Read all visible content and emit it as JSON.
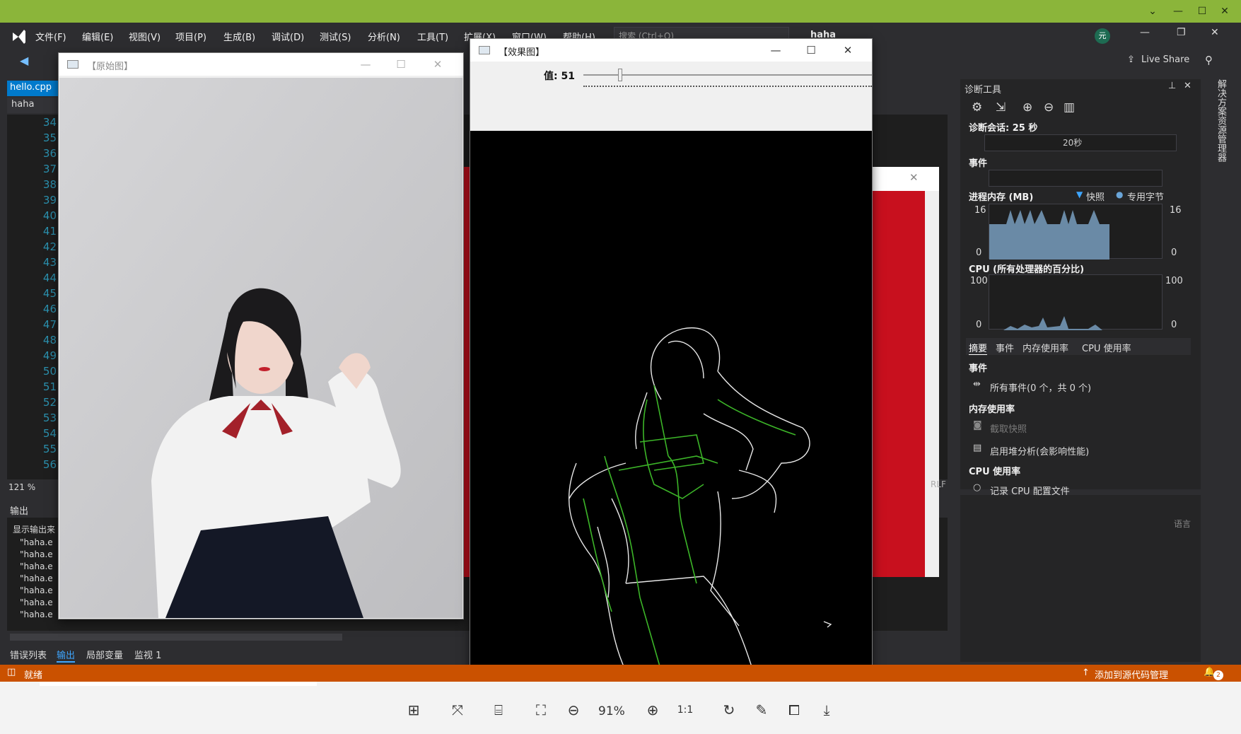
{
  "vs": {
    "menu": [
      "文件(F)",
      "编辑(E)",
      "视图(V)",
      "项目(P)",
      "生成(B)",
      "调试(D)",
      "测试(S)",
      "分析(N)",
      "工具(T)",
      "扩展(X)",
      "窗口(W)",
      "帮助(H)"
    ],
    "search_placeholder": "搜索 (Ctrl+Q)",
    "solution_name": "haha",
    "avatar": "元",
    "live_share": "Live Share",
    "editor_tab": "hello.cpp",
    "project_dropdown": "haha",
    "line_numbers": [
      "34",
      "35",
      "36",
      "37",
      "38",
      "39",
      "40",
      "41",
      "42",
      "43",
      "44",
      "45",
      "46",
      "47",
      "48",
      "49",
      "50",
      "51",
      "52",
      "53",
      "54",
      "55",
      "56"
    ],
    "zoom": "121 %",
    "output_title": "输出",
    "output_source_label": "显示输出来",
    "output_lines": [
      "\"haha.e",
      "\"haha.e",
      "\"haha.e",
      "\"haha.e",
      "\"haha.e",
      "\"haha.e",
      "\"haha.e"
    ],
    "bottom_tabs": [
      "错误列表",
      "输出",
      "局部变量",
      "监视 1"
    ],
    "status_text": "就绪",
    "source_control": "添加到源代码管理",
    "notification_count": "2",
    "side_tab": "解决方案资源管理器",
    "rlf": "RLF",
    "lang_label": "语言"
  },
  "diagnostics": {
    "title": "诊断工具",
    "session": "诊断会话: 25 秒",
    "timeline_label": "20秒",
    "events_label": "事件",
    "memory_label": "进程内存 (MB)",
    "snapshot_legend": "快照",
    "private_bytes_legend": "专用字节",
    "mem_max": "16",
    "mem_min": "0",
    "cpu_label": "CPU (所有处理器的百分比)",
    "cpu_max": "100",
    "cpu_min": "0",
    "tabs": [
      "摘要",
      "事件",
      "内存使用率",
      "CPU 使用率"
    ],
    "sec_events": "事件",
    "all_events": "所有事件(0 个，共 0 个)",
    "sec_memory": "内存使用率",
    "take_snapshot": "截取快照",
    "heap_analysis": "启用堆分析(会影响性能)",
    "sec_cpu": "CPU 使用率",
    "record_cpu": "记录 CPU 配置文件"
  },
  "orig_window": {
    "title": "【原始图】"
  },
  "effect_window": {
    "title": "【效果图】",
    "slider_label": "值: 51",
    "slider_value": 51
  },
  "viewer": {
    "zoom": "91%"
  },
  "colors": {
    "accent": "#007acc",
    "status": "#ca5100",
    "viewer_bar": "#8bb53a",
    "edge_green": "#3cb528"
  }
}
